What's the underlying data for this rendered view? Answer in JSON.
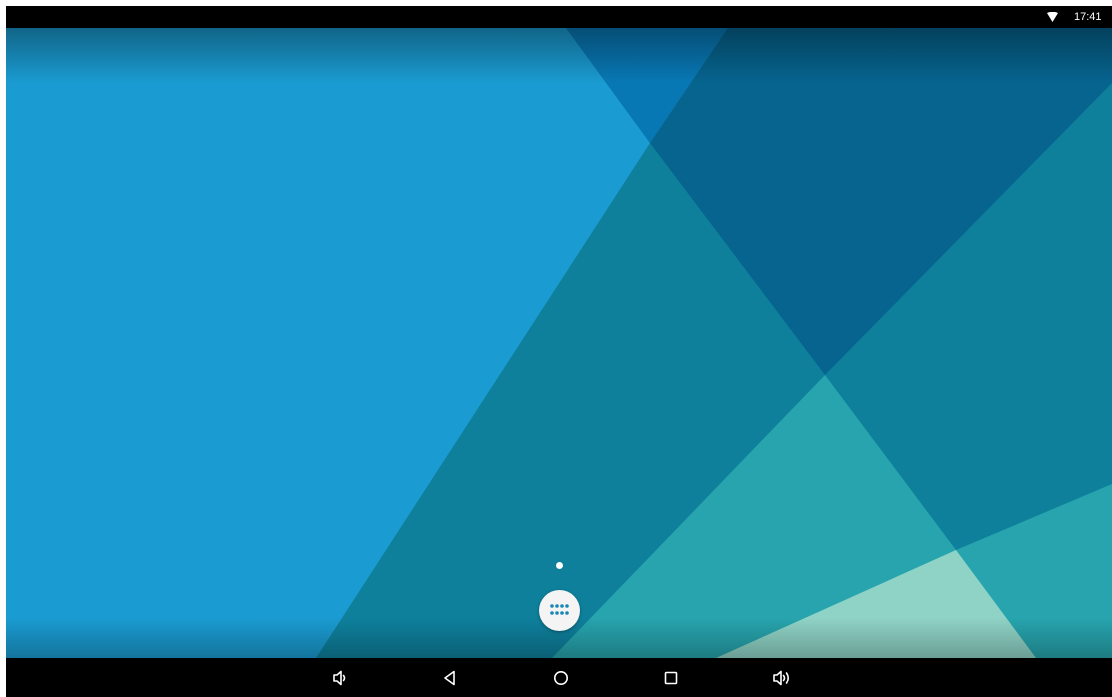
{
  "status_bar": {
    "time": "17:41",
    "icons": [
      "wifi-icon"
    ]
  },
  "home": {
    "page_count": 1,
    "current_page": 1,
    "all_apps_icon": "app-grid-icon"
  },
  "nav_bar": {
    "buttons": [
      {
        "name": "volume-down-button",
        "icon": "volume-down-icon"
      },
      {
        "name": "back-button",
        "icon": "back-triangle-icon"
      },
      {
        "name": "home-button",
        "icon": "home-circle-icon"
      },
      {
        "name": "recents-button",
        "icon": "recents-square-icon"
      },
      {
        "name": "volume-up-button",
        "icon": "volume-up-icon"
      }
    ]
  },
  "colors": {
    "wallpaper_light_blue": "#1a9bd1",
    "wallpaper_teal": "#0e809c",
    "wallpaper_dark_blue": "#06648f",
    "wallpaper_mid_blue": "#0878b5",
    "wallpaper_cyan": "#27a4ad",
    "wallpaper_mint": "#8fd3c6",
    "bar_background": "#000000"
  }
}
